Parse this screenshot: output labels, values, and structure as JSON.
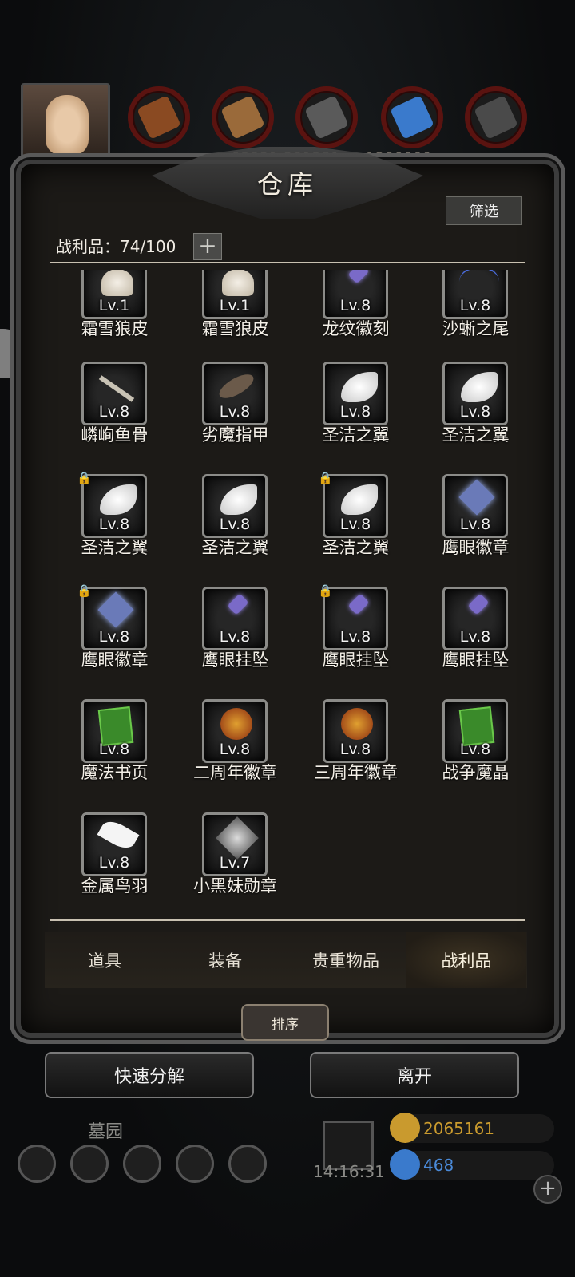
{
  "top": {
    "resource_numbers": "92221  201251  ...  1200000",
    "resources": [
      {
        "icon": "leather-icon",
        "color": "#8a4a22"
      },
      {
        "icon": "wood-icon",
        "color": "#9a6a3a"
      },
      {
        "icon": "iron-icon",
        "color": "#5a5a5a"
      },
      {
        "icon": "crystal-icon",
        "color": "#3a7acc"
      },
      {
        "icon": "ore-icon",
        "color": "#4a4a4a"
      }
    ]
  },
  "panel": {
    "title": "仓库",
    "filter_label": "筛选",
    "count_label": "战利品：74/100",
    "add_label": "+"
  },
  "items": [
    {
      "lv": "Lv.1",
      "name": "霜雪狼皮",
      "icon": "fur-icon",
      "locked": false
    },
    {
      "lv": "Lv.1",
      "name": "霜雪狼皮",
      "icon": "fur-icon",
      "locked": false
    },
    {
      "lv": "Lv.8",
      "name": "龙纹徽刻",
      "icon": "pendant-icon",
      "locked": false
    },
    {
      "lv": "Lv.8",
      "name": "沙蜥之尾",
      "icon": "tail-icon",
      "locked": false
    },
    {
      "lv": "Lv.8",
      "name": "嶙峋鱼骨",
      "icon": "fishbone-icon",
      "locked": false
    },
    {
      "lv": "Lv.8",
      "name": "劣魔指甲",
      "icon": "claw-icon",
      "locked": false
    },
    {
      "lv": "Lv.8",
      "name": "圣洁之翼",
      "icon": "wing-icon",
      "locked": false
    },
    {
      "lv": "Lv.8",
      "name": "圣洁之翼",
      "icon": "wing-icon",
      "locked": false
    },
    {
      "lv": "Lv.8",
      "name": "圣洁之翼",
      "icon": "wing-icon",
      "locked": true
    },
    {
      "lv": "Lv.8",
      "name": "圣洁之翼",
      "icon": "wing-icon",
      "locked": false
    },
    {
      "lv": "Lv.8",
      "name": "圣洁之翼",
      "icon": "wing-icon",
      "locked": true
    },
    {
      "lv": "Lv.8",
      "name": "鹰眼徽章",
      "icon": "badge-icon",
      "locked": false
    },
    {
      "lv": "Lv.8",
      "name": "鹰眼徽章",
      "icon": "badge-icon",
      "locked": true
    },
    {
      "lv": "Lv.8",
      "name": "鹰眼挂坠",
      "icon": "pendant-icon",
      "locked": false
    },
    {
      "lv": "Lv.8",
      "name": "鹰眼挂坠",
      "icon": "pendant-icon",
      "locked": true
    },
    {
      "lv": "Lv.8",
      "name": "鹰眼挂坠",
      "icon": "pendant-icon",
      "locked": false
    },
    {
      "lv": "Lv.8",
      "name": "魔法书页",
      "icon": "page-icon",
      "locked": false
    },
    {
      "lv": "Lv.8",
      "name": "二周年徽章",
      "icon": "emblem-icon",
      "locked": false
    },
    {
      "lv": "Lv.8",
      "name": "三周年徽章",
      "icon": "emblem-icon",
      "locked": false
    },
    {
      "lv": "Lv.8",
      "name": "战争魔晶",
      "icon": "page-icon",
      "locked": false
    },
    {
      "lv": "Lv.8",
      "name": "金属鸟羽",
      "icon": "feather-icon",
      "locked": false
    },
    {
      "lv": "Lv.7",
      "name": "小黑妹勋章",
      "icon": "crystal-medal-icon",
      "locked": false
    }
  ],
  "tabs": [
    {
      "label": "道具",
      "active": false
    },
    {
      "label": "装备",
      "active": false
    },
    {
      "label": "贵重物品",
      "active": false
    },
    {
      "label": "战利品",
      "active": true
    }
  ],
  "buttons": {
    "sort": "排序",
    "quick_decompose": "快速分解",
    "leave": "离开"
  },
  "hud": {
    "location": "墓园",
    "timer": "14:16:31",
    "gold": "2065161",
    "gems": "468",
    "gold_color": "#c99a2e",
    "gem_color": "#3a7acc"
  }
}
